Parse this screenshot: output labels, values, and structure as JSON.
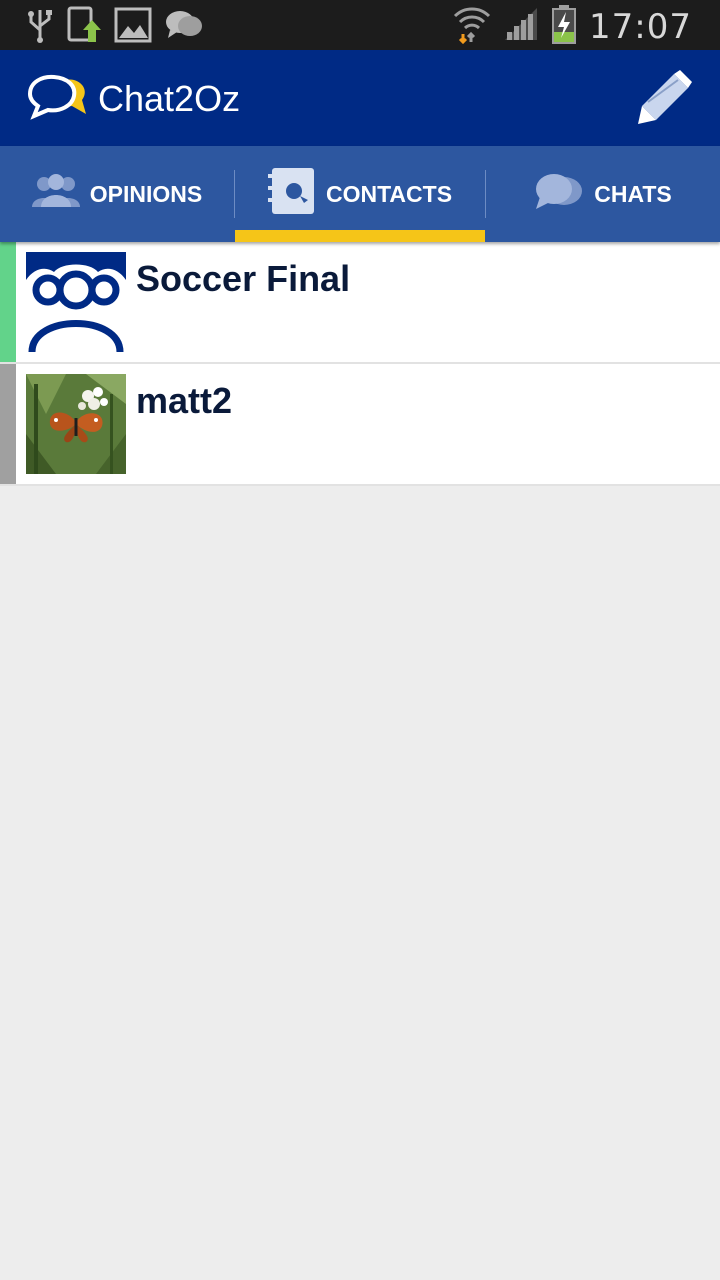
{
  "statusbar": {
    "time": "17:07",
    "icons": [
      "usb-icon",
      "phone-update-icon",
      "image-icon",
      "chat-notification-icon",
      "wifi-icon",
      "signal-icon",
      "battery-charging-icon"
    ]
  },
  "appbar": {
    "title": "Chat2Oz",
    "logo_icon": "chat-bubbles-icon",
    "compose_icon": "pencil-icon"
  },
  "tabs": [
    {
      "label": "OPINIONS",
      "icon": "people-icon",
      "selected": false
    },
    {
      "label": "CONTACTS",
      "icon": "contact-book-icon",
      "selected": true
    },
    {
      "label": "CHATS",
      "icon": "chat-bubbles-icon",
      "selected": false
    }
  ],
  "colors": {
    "appbar": "#002a85",
    "tabbar": "#2d57a0",
    "tab_indicator": "#f5c518",
    "status_green": "#62d38a",
    "status_gray": "#a0a0a0"
  },
  "contacts": [
    {
      "name": "Soccer Final",
      "avatar": "group-avatar-icon",
      "status_color": "#62d38a"
    },
    {
      "name": "matt2",
      "avatar": "butterfly-photo",
      "status_color": "#a0a0a0"
    }
  ]
}
